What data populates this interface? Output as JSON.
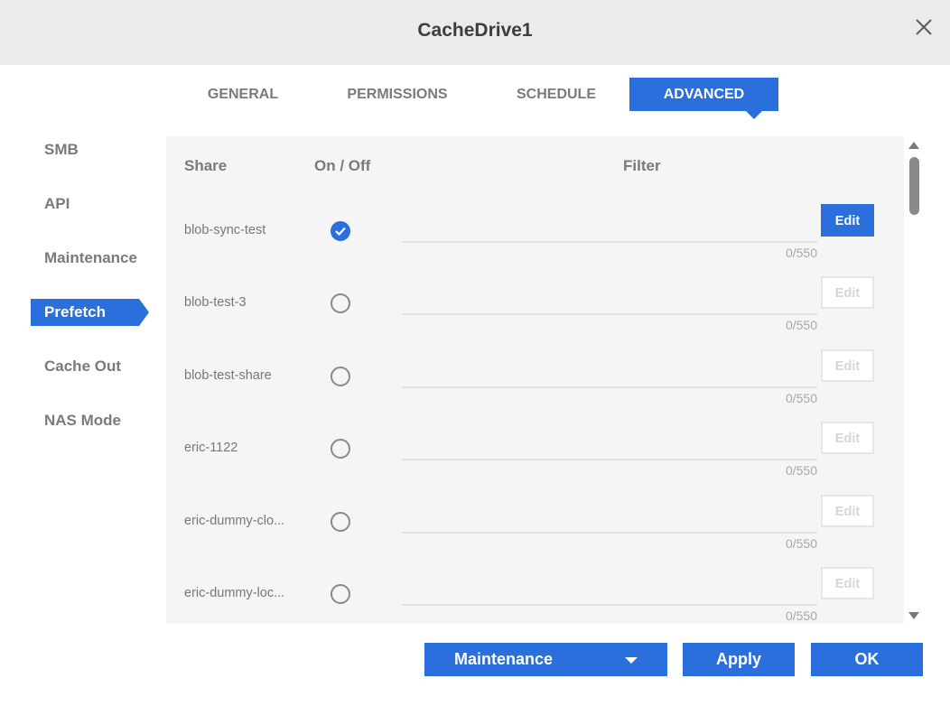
{
  "window": {
    "title": "CacheDrive1"
  },
  "tabs": [
    {
      "label": "GENERAL"
    },
    {
      "label": "PERMISSIONS"
    },
    {
      "label": "SCHEDULE"
    },
    {
      "label": "ADVANCED",
      "active": true
    }
  ],
  "sidebar": {
    "items": [
      {
        "label": "SMB"
      },
      {
        "label": "API"
      },
      {
        "label": "Maintenance"
      },
      {
        "label": "Prefetch",
        "active": true
      },
      {
        "label": "Cache Out"
      },
      {
        "label": "NAS Mode"
      }
    ]
  },
  "table": {
    "headers": {
      "share": "Share",
      "onoff": "On / Off",
      "filter": "Filter"
    },
    "rows": [
      {
        "share": "blob-sync-test",
        "on": true,
        "filter": "",
        "counter": "0/550",
        "edit_label": "Edit",
        "edit_enabled": true
      },
      {
        "share": "blob-test-3",
        "on": false,
        "filter": "",
        "counter": "0/550",
        "edit_label": "Edit",
        "edit_enabled": false
      },
      {
        "share": "blob-test-share",
        "on": false,
        "filter": "",
        "counter": "0/550",
        "edit_label": "Edit",
        "edit_enabled": false
      },
      {
        "share": "eric-1122",
        "on": false,
        "filter": "",
        "counter": "0/550",
        "edit_label": "Edit",
        "edit_enabled": false
      },
      {
        "share": "eric-dummy-clo...",
        "on": false,
        "filter": "",
        "counter": "0/550",
        "edit_label": "Edit",
        "edit_enabled": false
      },
      {
        "share": "eric-dummy-loc...",
        "on": false,
        "filter": "",
        "counter": "0/550",
        "edit_label": "Edit",
        "edit_enabled": false
      }
    ]
  },
  "footer": {
    "dropdown_label": "Maintenance",
    "apply_label": "Apply",
    "ok_label": "OK"
  },
  "icons": {
    "close": "close-icon",
    "check": "check-icon",
    "dropdown": "chevron-down-icon",
    "scroll_up": "scroll-up-arrow-icon",
    "scroll_down": "scroll-down-arrow-icon"
  },
  "colors": {
    "accent": "#2a6fdb",
    "titlebar": "#ebebeb",
    "panel": "#f5f5f5"
  }
}
